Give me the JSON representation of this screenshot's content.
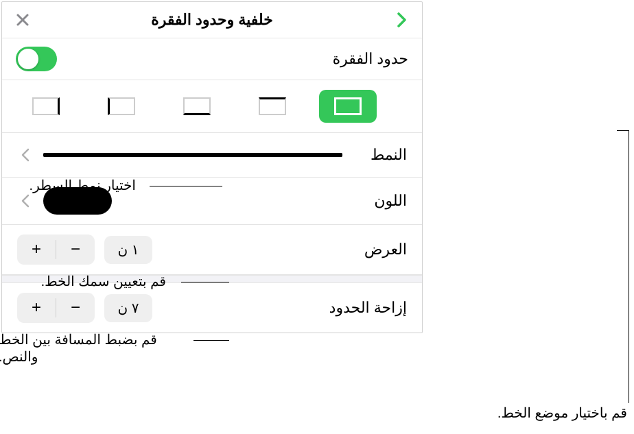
{
  "header": {
    "title": "خلفية وحدود الفقرة"
  },
  "borders": {
    "toggle_label": "حدود الفقرة",
    "toggle_on": true
  },
  "style": {
    "label": "النمط"
  },
  "color": {
    "label": "اللون",
    "value": "#000000"
  },
  "width": {
    "label": "العرض",
    "value": "١ ن"
  },
  "offset": {
    "label": "إزاحة الحدود",
    "value": "٧ ن"
  },
  "callouts": {
    "style": "اختيار نمط السطر.",
    "width": "قم بتعيين سمك الخط.",
    "offset": "قم بضبط المسافة بين الخط والنص.",
    "position": "قم باختيار موضع الخط."
  }
}
